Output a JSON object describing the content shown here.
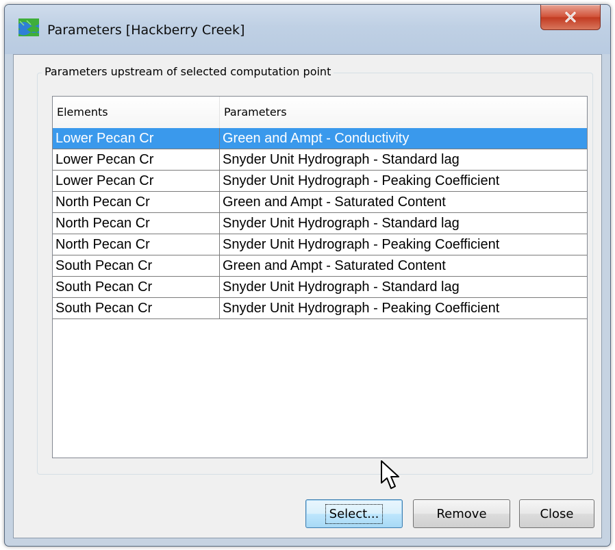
{
  "window": {
    "title": "Parameters [Hackberry Creek]",
    "close_glyph": "x"
  },
  "group": {
    "legend": "Parameters upstream of selected computation point"
  },
  "table": {
    "columns": [
      "Elements",
      "Parameters"
    ],
    "rows": [
      {
        "element": "Lower Pecan Cr",
        "parameter": "Green and Ampt - Conductivity",
        "selected": true
      },
      {
        "element": "Lower Pecan Cr",
        "parameter": "Snyder Unit Hydrograph - Standard lag",
        "selected": false
      },
      {
        "element": "Lower Pecan Cr",
        "parameter": "Snyder Unit Hydrograph - Peaking Coefficient",
        "selected": false
      },
      {
        "element": "North Pecan Cr",
        "parameter": "Green and Ampt - Saturated Content",
        "selected": false
      },
      {
        "element": "North Pecan Cr",
        "parameter": "Snyder Unit Hydrograph - Standard lag",
        "selected": false
      },
      {
        "element": "North Pecan Cr",
        "parameter": "Snyder Unit Hydrograph - Peaking Coefficient",
        "selected": false
      },
      {
        "element": "South Pecan Cr",
        "parameter": "Green and Ampt - Saturated Content",
        "selected": false
      },
      {
        "element": "South Pecan Cr",
        "parameter": "Snyder Unit Hydrograph - Standard lag",
        "selected": false
      },
      {
        "element": "South Pecan Cr",
        "parameter": "Snyder Unit Hydrograph - Peaking Coefficient",
        "selected": false
      }
    ]
  },
  "buttons": {
    "select": "Select...",
    "remove": "Remove",
    "close": "Close"
  },
  "colors": {
    "selection": "#3a99ec",
    "titlebar": "#bfd0e4",
    "close_button": "#c23b22"
  },
  "icons": {
    "app": "watershed-icon",
    "close": "close-icon",
    "pointer": "mouse-pointer-icon"
  }
}
